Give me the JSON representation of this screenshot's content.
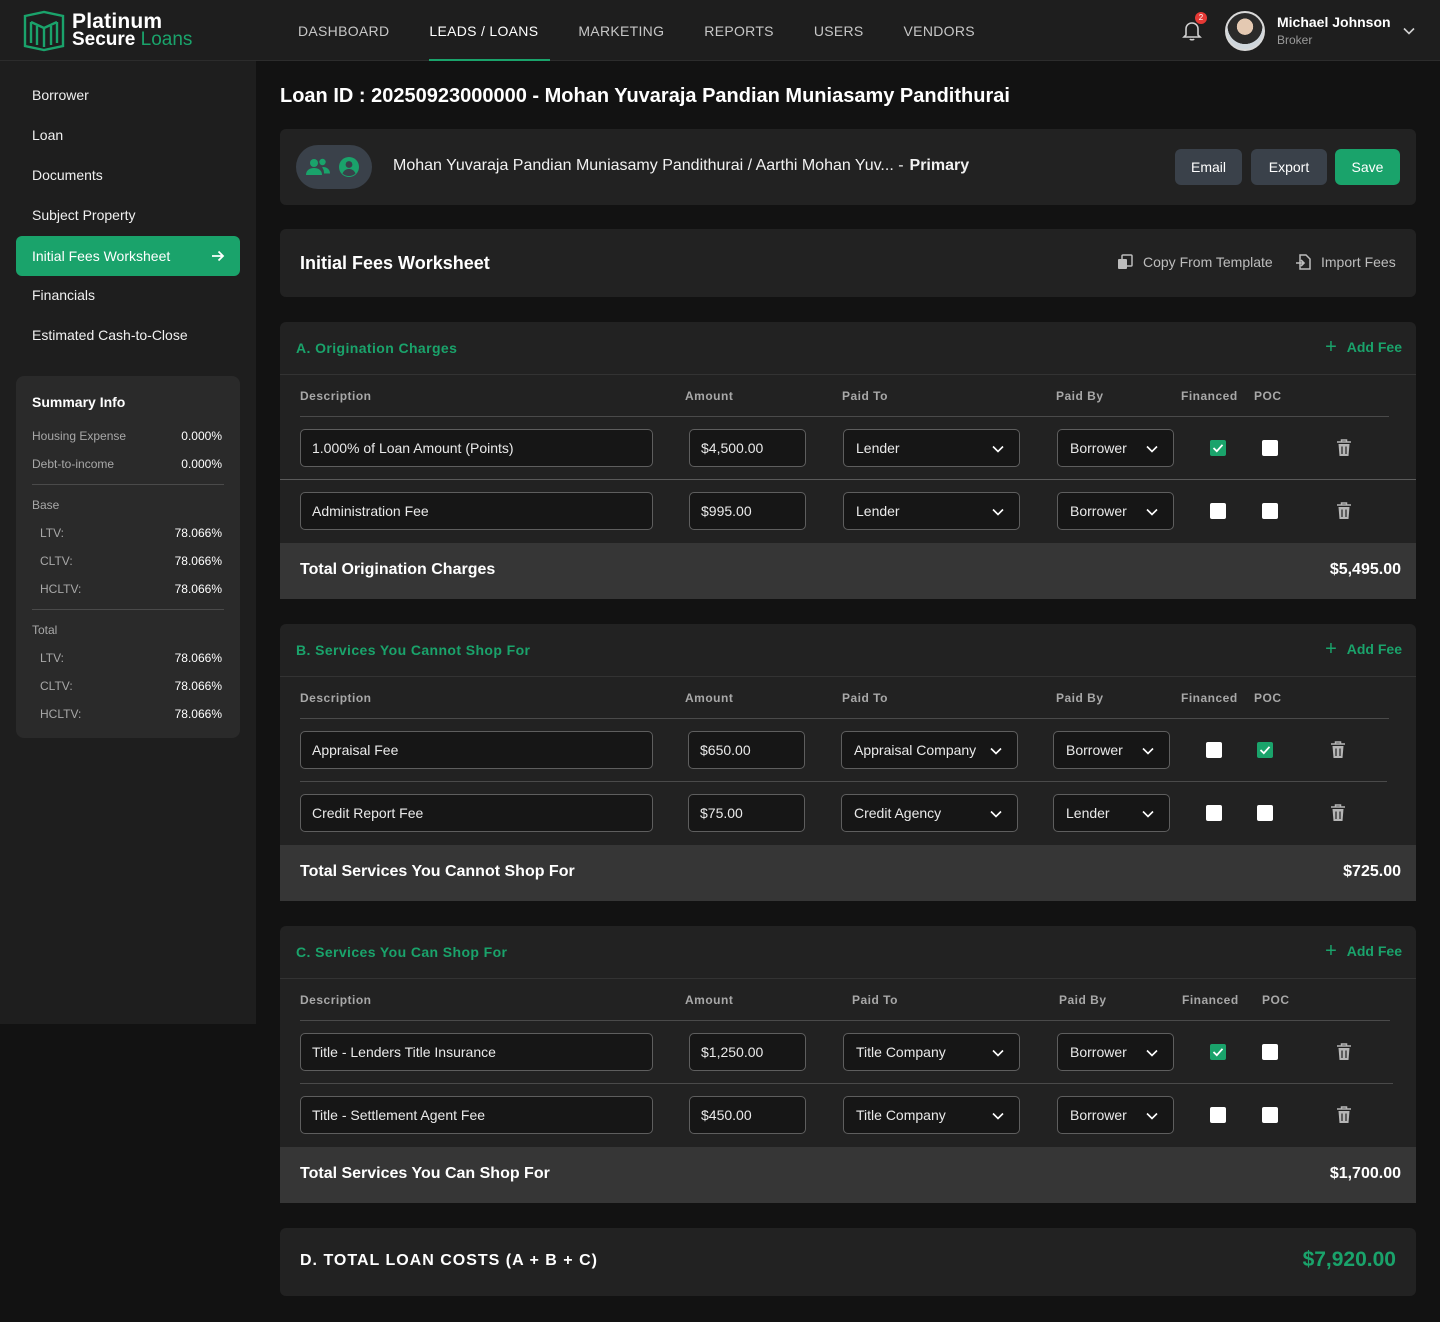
{
  "brand": {
    "line1": "Platinum",
    "line2a": "Secure",
    "line2b": "Loans"
  },
  "nav": [
    "DASHBOARD",
    "LEADS / LOANS",
    "MARKETING",
    "REPORTS",
    "USERS",
    "VENDORS"
  ],
  "notifications": {
    "count": "2"
  },
  "user": {
    "name": "Michael Johnson",
    "role": "Broker"
  },
  "sidebar": [
    "Borrower",
    "Loan",
    "Documents",
    "Subject Property",
    "Initial Fees Worksheet",
    "Financials",
    "Estimated Cash-to-Close"
  ],
  "summary": {
    "title": "Summary Info",
    "housing_label": "Housing Expense",
    "housing_value": "0.000%",
    "dti_label": "Debt-to-income",
    "dti_value": "0.000%",
    "base_label": "Base",
    "base": [
      {
        "label": "LTV:",
        "value": "78.066%"
      },
      {
        "label": "CLTV:",
        "value": "78.066%"
      },
      {
        "label": "HCLTV:",
        "value": "78.066%"
      }
    ],
    "total_label": "Total",
    "total": [
      {
        "label": "LTV:",
        "value": "78.066%"
      },
      {
        "label": "CLTV:",
        "value": "78.066%"
      },
      {
        "label": "HCLTV:",
        "value": "78.066%"
      }
    ]
  },
  "page_title": "Loan ID : 20250923000000 - Mohan Yuvaraja Pandian Muniasamy Pandithurai",
  "borrower": {
    "names": "Mohan Yuvaraja Pandian Muniasamy Pandithurai / Aarthi Mohan Yuv... -",
    "primary": "Primary"
  },
  "actions": {
    "email": "Email",
    "export": "Export",
    "save": "Save"
  },
  "worksheet": {
    "title": "Initial Fees Worksheet",
    "copy": "Copy From Template",
    "import": "Import Fees"
  },
  "columns": {
    "description": "Description",
    "amount": "Amount",
    "paid_to": "Paid To",
    "paid_by": "Paid By",
    "financed": "Financed",
    "poc": "POC"
  },
  "add_fee": "Add Fee",
  "sections": [
    {
      "title": "A. Origination Charges",
      "rows": [
        {
          "description": "1.000% of Loan Amount (Points)",
          "amount": "$4,500.00",
          "paid_to": "Lender",
          "paid_by": "Borrower",
          "financed": true,
          "poc": false
        },
        {
          "description": "Administration Fee",
          "amount": "$995.00",
          "paid_to": "Lender",
          "paid_by": "Borrower",
          "financed": false,
          "poc": false
        }
      ],
      "total_label": "Total Origination Charges",
      "total_value": "$5,495.00"
    },
    {
      "title": "B. Services You Cannot Shop For",
      "rows": [
        {
          "description": "Appraisal Fee",
          "amount": "$650.00",
          "paid_to": "Appraisal Company",
          "paid_by": "Borrower",
          "financed": false,
          "poc": true
        },
        {
          "description": "Credit Report Fee",
          "amount": "$75.00",
          "paid_to": "Credit Agency",
          "paid_by": "Lender",
          "financed": false,
          "poc": false
        }
      ],
      "total_label": "Total Services You Cannot Shop For",
      "total_value": "$725.00"
    },
    {
      "title": "C. Services You Can Shop For",
      "rows": [
        {
          "description": "Title - Lenders Title Insurance",
          "amount": "$1,250.00",
          "paid_to": "Title Company",
          "paid_by": "Borrower",
          "financed": true,
          "poc": false
        },
        {
          "description": "Title - Settlement Agent Fee",
          "amount": "$450.00",
          "paid_to": "Title Company",
          "paid_by": "Borrower",
          "financed": false,
          "poc": false
        }
      ],
      "total_label": "Total Services You Can Shop For",
      "total_value": "$1,700.00"
    }
  ],
  "grand_total": {
    "label": "D. TOTAL LOAN COSTS (A + B + C)",
    "value": "$7,920.00"
  },
  "colors": {
    "accent": "#1aa36b",
    "background": "#121212",
    "panel": "#222222",
    "total_bar": "#363636"
  }
}
